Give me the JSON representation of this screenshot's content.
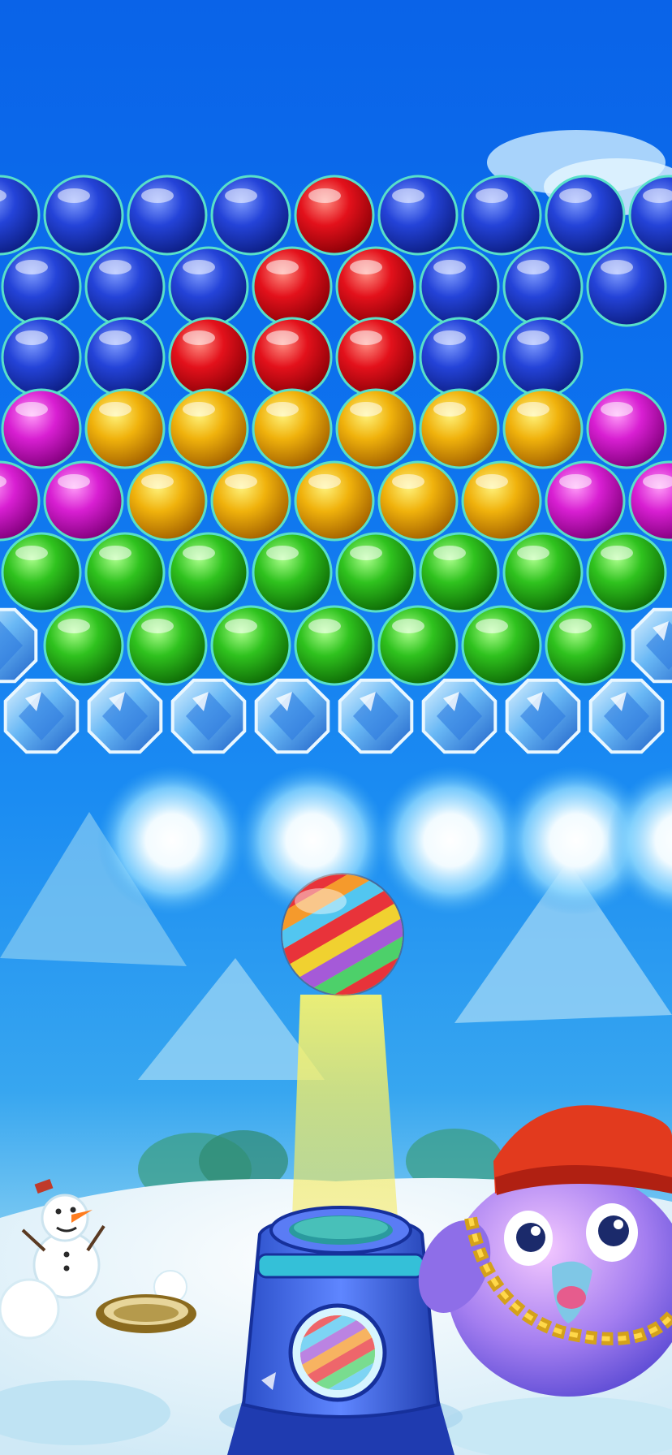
{
  "game": {
    "genre": "bubble-shooter",
    "colors": {
      "blue": "#1f3fd6",
      "red": "#e3111b",
      "yellow": "#f0b20c",
      "magenta": "#d81fd2",
      "green": "#2fc21e",
      "ice": "#69b8f5"
    },
    "grid": [
      [
        "blue",
        "blue",
        "blue",
        "blue",
        "red",
        "blue",
        "blue",
        "blue",
        "blue"
      ],
      [
        "blue",
        "blue",
        "blue",
        "red",
        "red",
        "blue",
        "blue",
        "blue"
      ],
      [
        "blue",
        "blue",
        "red",
        "red",
        "red",
        "blue",
        "blue"
      ],
      [
        "magenta",
        "yellow",
        "yellow",
        "yellow",
        "yellow",
        "yellow",
        "yellow",
        "magenta"
      ],
      [
        "magenta",
        "magenta",
        "yellow",
        "yellow",
        "yellow",
        "yellow",
        "yellow",
        "magenta",
        "magenta"
      ],
      [
        "green",
        "green",
        "green",
        "green",
        "green",
        "green",
        "green",
        "green"
      ],
      [
        "ice",
        "green",
        "green",
        "green",
        "green",
        "green",
        "green",
        "green",
        "ice"
      ],
      [
        "ice",
        "ice",
        "ice",
        "ice",
        "ice",
        "ice",
        "ice",
        "ice"
      ]
    ],
    "frozen_bursts": 5,
    "active_bubble": "rainbow-striped",
    "next_bubble": "rainbow-striped",
    "characters": [
      "snowman",
      "bird-mascot"
    ],
    "mascot_accessories": [
      "red-cap",
      "gold-chain"
    ]
  }
}
